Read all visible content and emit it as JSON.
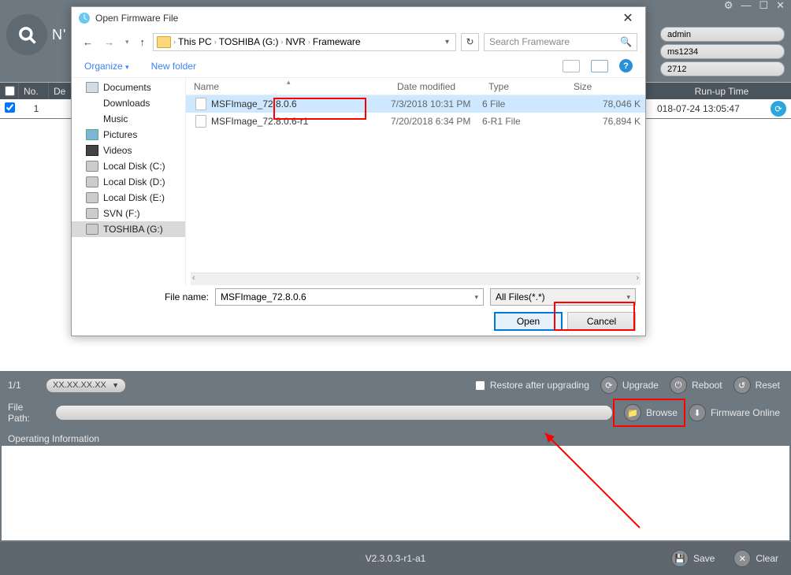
{
  "app": {
    "logo": "N'"
  },
  "credentials": {
    "user": "admin",
    "pass": "ms1234",
    "port": "2712"
  },
  "bg_table": {
    "headers": {
      "no": "No.",
      "de": "De",
      "runup": "Run-up Time"
    },
    "row": {
      "no": "1",
      "runup": "018-07-24 13:05:47"
    }
  },
  "dialog": {
    "title": "Open Firmware File",
    "breadcrumb": [
      "This PC",
      "TOSHIBA (G:)",
      "NVR",
      "Frameware"
    ],
    "search_placeholder": "Search Frameware",
    "organize": "Organize",
    "new_folder": "New folder",
    "nav": [
      {
        "label": "Documents",
        "cls": "docs"
      },
      {
        "label": "Downloads",
        "cls": "down"
      },
      {
        "label": "Music",
        "cls": "music"
      },
      {
        "label": "Pictures",
        "cls": "pics"
      },
      {
        "label": "Videos",
        "cls": "vids"
      },
      {
        "label": "Local Disk (C:)",
        "cls": "disk"
      },
      {
        "label": "Local Disk (D:)",
        "cls": "disk"
      },
      {
        "label": "Local Disk (E:)",
        "cls": "disk"
      },
      {
        "label": "SVN (F:)",
        "cls": "disk"
      },
      {
        "label": "TOSHIBA (G:)",
        "cls": "disk",
        "sel": true
      }
    ],
    "columns": {
      "name": "Name",
      "date": "Date modified",
      "type": "Type",
      "size": "Size"
    },
    "files": [
      {
        "name": "MSFImage_72.8.0.6",
        "date": "7/3/2018 10:31 PM",
        "type": "6 File",
        "size": "78,046 K",
        "sel": true
      },
      {
        "name": "MSFImage_72.8.0.6-r1",
        "date": "7/20/2018 6:34 PM",
        "type": "6-R1 File",
        "size": "76,894 K"
      }
    ],
    "file_name_label": "File name:",
    "file_name_value": "MSFImage_72.8.0.6",
    "file_type_value": "All Files(*.*)",
    "open": "Open",
    "cancel": "Cancel"
  },
  "bottom": {
    "pager": "1/1",
    "ip": "XX.XX.XX.XX",
    "restore": "Restore after upgrading",
    "upgrade": "Upgrade",
    "reboot": "Reboot",
    "reset": "Reset",
    "file_path": "File Path:",
    "browse": "Browse",
    "fw_online": "Firmware Online",
    "op_info": "Operating Information",
    "save": "Save",
    "clear": "Clear",
    "version": "V2.3.0.3-r1-a1"
  }
}
